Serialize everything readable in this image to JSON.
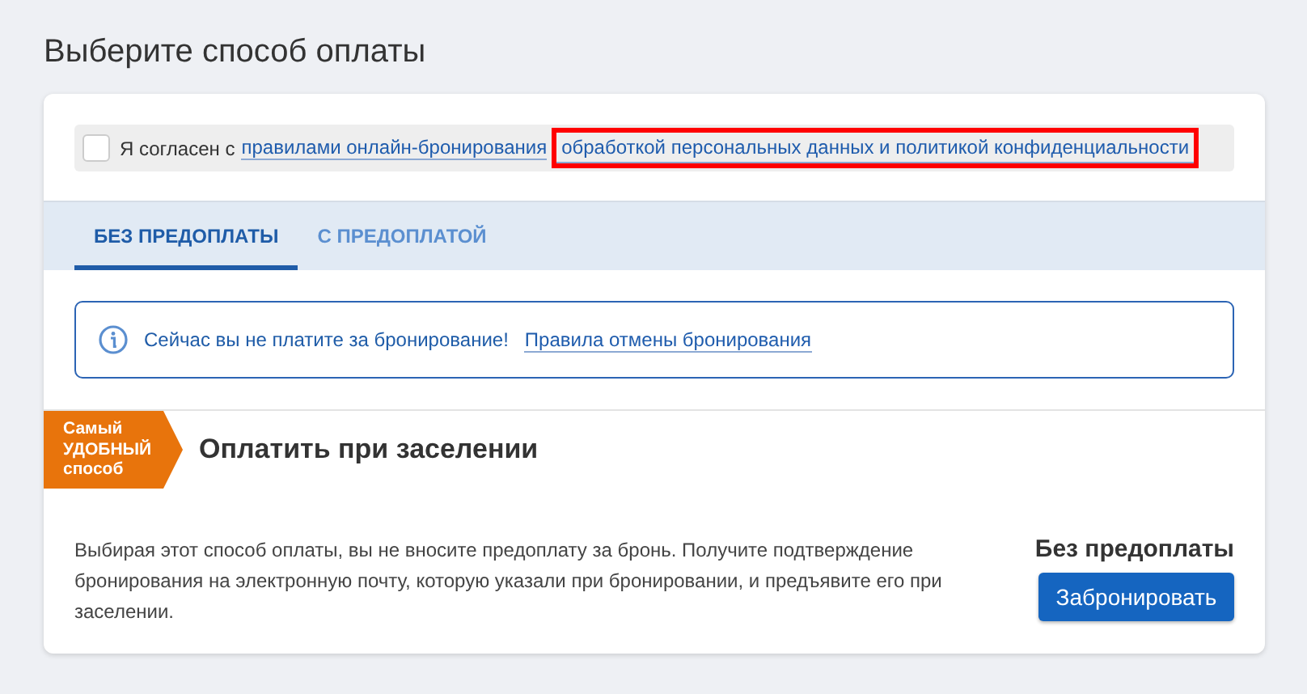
{
  "page_title": "Выберите способ оплаты",
  "consent": {
    "checked": false,
    "text": "Я согласен с",
    "links": [
      {
        "text": "правилами онлайн-бронирования",
        "highlighted": false
      },
      {
        "text": "обработкой персональных данных и политикой конфиденциальности",
        "highlighted": true
      }
    ]
  },
  "tabs": [
    {
      "label": "БЕЗ ПРЕДОПЛАТЫ",
      "selected": true
    },
    {
      "label": "С ПРЕДОПЛАТОЙ",
      "selected": false
    }
  ],
  "notice": {
    "text": "Сейчас вы не платите за бронирование!",
    "link": "Правила отмены бронирования"
  },
  "option": {
    "badge": [
      "Самый",
      "УДОБНЫЙ",
      "способ"
    ],
    "title": "Оплатить при заселении",
    "description": "Выбирая этот способ оплаты, вы не вносите предоплату за бронь. Получите подтверждение бронирования на электронную почту, которую указали при бронировании, и предъявите его при заселении.",
    "price_label": "Без предоплаты",
    "button": "Забронировать"
  }
}
